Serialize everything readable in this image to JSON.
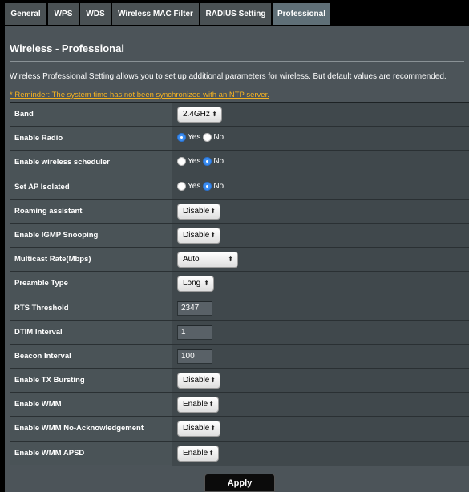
{
  "tabs": [
    {
      "label": "General",
      "active": false
    },
    {
      "label": "WPS",
      "active": false
    },
    {
      "label": "WDS",
      "active": false
    },
    {
      "label": "Wireless MAC Filter",
      "active": false
    },
    {
      "label": "RADIUS Setting",
      "active": false
    },
    {
      "label": "Professional",
      "active": true
    }
  ],
  "panel": {
    "title": "Wireless - Professional",
    "description": "Wireless Professional Setting allows you to set up additional parameters for wireless. But default values are recommended.",
    "reminder": "* Reminder: The system time has not been synchronized with an NTP server."
  },
  "settings": {
    "band": {
      "label": "Band",
      "value": "2.4GHz"
    },
    "enable_radio": {
      "label": "Enable Radio",
      "yes": "Yes",
      "no": "No",
      "selected": "yes"
    },
    "wireless_scheduler": {
      "label": "Enable wireless scheduler",
      "yes": "Yes",
      "no": "No",
      "selected": "no"
    },
    "ap_isolated": {
      "label": "Set AP Isolated",
      "yes": "Yes",
      "no": "No",
      "selected": "no"
    },
    "roaming_assistant": {
      "label": "Roaming assistant",
      "value": "Disable"
    },
    "igmp_snooping": {
      "label": "Enable IGMP Snooping",
      "value": "Disable"
    },
    "multicast_rate": {
      "label": "Multicast Rate(Mbps)",
      "value": "Auto"
    },
    "preamble_type": {
      "label": "Preamble Type",
      "value": "Long"
    },
    "rts_threshold": {
      "label": "RTS Threshold",
      "value": "2347"
    },
    "dtim_interval": {
      "label": "DTIM Interval",
      "value": "1"
    },
    "beacon_interval": {
      "label": "Beacon Interval",
      "value": "100"
    },
    "tx_bursting": {
      "label": "Enable TX Bursting",
      "value": "Disable"
    },
    "wmm": {
      "label": "Enable WMM",
      "value": "Enable"
    },
    "wmm_no_ack": {
      "label": "Enable WMM No-Acknowledgement",
      "value": "Disable"
    },
    "wmm_apsd": {
      "label": "Enable WMM APSD",
      "value": "Enable"
    }
  },
  "icons": {
    "select_arrow": "updown-arrow-icon",
    "select_arrow_glyph": "⬍"
  },
  "apply_label": "Apply",
  "colors": {
    "accent_radio": "#3b8df2",
    "reminder": "#f5b321",
    "active_tab": "#5f6f77"
  }
}
